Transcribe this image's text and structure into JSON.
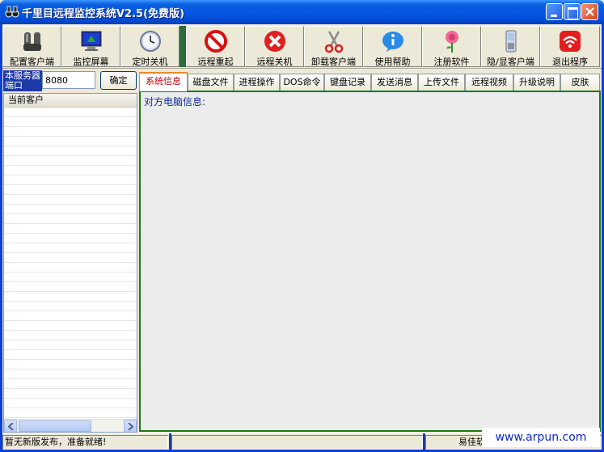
{
  "window": {
    "title": "千里目远程监控系统V2.5(免费版)"
  },
  "toolbar": {
    "items": [
      {
        "label": "配置客户端",
        "icon": "config-client-icon"
      },
      {
        "label": "监控屏幕",
        "icon": "monitor-screen-icon"
      },
      {
        "label": "定时关机",
        "icon": "timer-clock-icon"
      },
      {
        "label": "远程重起",
        "icon": "no-entry-icon"
      },
      {
        "label": "远程关机",
        "icon": "red-x-icon"
      },
      {
        "label": "卸载客户端",
        "icon": "scissors-icon"
      },
      {
        "label": "使用帮助",
        "icon": "info-icon"
      },
      {
        "label": "注册软件",
        "icon": "rose-icon"
      },
      {
        "label": "隐/显客户端",
        "icon": "phone-icon"
      },
      {
        "label": "退出程序",
        "icon": "exit-wifi-icon"
      }
    ]
  },
  "port": {
    "label": "本服务器端口",
    "value": "8080",
    "ok_label": "确定"
  },
  "client_list": {
    "header": "当前客户"
  },
  "tabs": [
    {
      "label": "系统信息",
      "active": true
    },
    {
      "label": "磁盘文件"
    },
    {
      "label": "进程操作"
    },
    {
      "label": "DOS命令"
    },
    {
      "label": "键盘记录"
    },
    {
      "label": "发送消息"
    },
    {
      "label": "上传文件"
    },
    {
      "label": "远程视频"
    },
    {
      "label": "升级说明"
    },
    {
      "label": "皮肤"
    }
  ],
  "content": {
    "text": "对方电脑信息:"
  },
  "statusbar": {
    "message": "暂无新版发布，准备就绪!",
    "right_text": "易佳软"
  },
  "watermark": "www.arpun.com",
  "colors": {
    "titlebar": "#0454e0",
    "active_tab_text": "#c00000",
    "content_border": "#1a7a1a",
    "port_label_bg": "#1c3aa8"
  }
}
